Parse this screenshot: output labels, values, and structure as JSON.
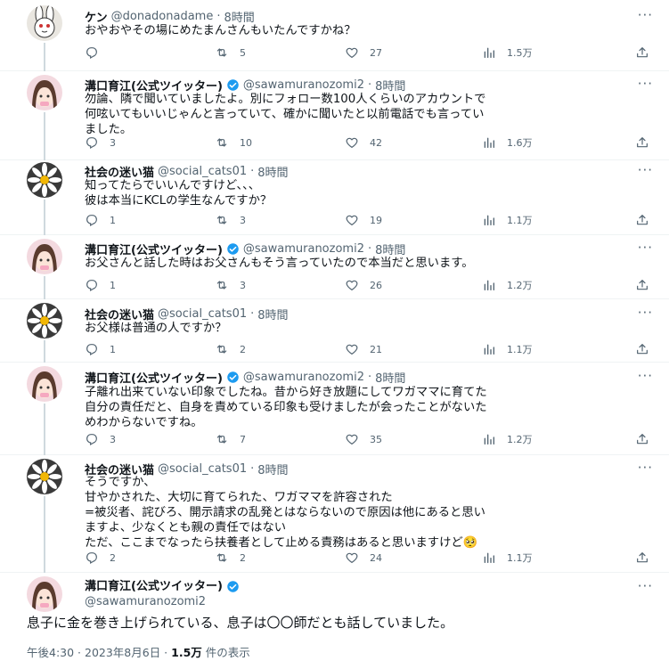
{
  "replies": [
    {
      "name": "ケン",
      "handle": "@donadonadame",
      "separator": "·",
      "time": "8時間",
      "verified": false,
      "avatar": "rabbit-avatar",
      "lines": [
        "おやおやその場にめたまんさんもいたんですかね？"
      ],
      "counts": {
        "reply": "",
        "retweet": "5",
        "like": "27",
        "views": "1.5万"
      }
    },
    {
      "name": "溝口育江(公式ツイッター)",
      "handle": "@sawamuranozomi2",
      "separator": "·",
      "time": "8時間",
      "verified": true,
      "avatar": "girl-avatar",
      "lines": [
        "勿論、隣で聞いていましたよ。別にフォロー数100人くらいのアカウントで",
        "何呟いてもいいじゃんと言っていて、確かに聞いたと以前電話でも言ってい",
        "ました。"
      ],
      "counts": {
        "reply": "3",
        "retweet": "10",
        "like": "42",
        "views": "1.6万"
      }
    },
    {
      "name": "社会の迷い猫",
      "handle": "@social_cats01",
      "separator": "·",
      "time": "8時間",
      "verified": false,
      "avatar": "daisy-avatar",
      "lines": [
        "知ってたらでいいんですけど、、、",
        "彼は本当にKCLの学生なんですか？"
      ],
      "counts": {
        "reply": "1",
        "retweet": "3",
        "like": "19",
        "views": "1.1万"
      }
    },
    {
      "name": "溝口育江(公式ツイッター)",
      "handle": "@sawamuranozomi2",
      "separator": "·",
      "time": "8時間",
      "verified": true,
      "avatar": "girl-avatar",
      "lines": [
        "お父さんと話した時はお父さんもそう言っていたので本当だと思います。"
      ],
      "counts": {
        "reply": "1",
        "retweet": "3",
        "like": "26",
        "views": "1.2万"
      }
    },
    {
      "name": "社会の迷い猫",
      "handle": "@social_cats01",
      "separator": "·",
      "time": "8時間",
      "verified": false,
      "avatar": "daisy-avatar",
      "lines": [
        "お父様は普通の人ですか？"
      ],
      "counts": {
        "reply": "1",
        "retweet": "2",
        "like": "21",
        "views": "1.1万"
      }
    },
    {
      "name": "溝口育江(公式ツイッター)",
      "handle": "@sawamuranozomi2",
      "separator": "·",
      "time": "8時間",
      "verified": true,
      "avatar": "girl-avatar",
      "lines": [
        "子離れ出来ていない印象でしたね。昔から好き放題にしてワガママに育てた",
        "自分の責任だと、自身を責めている印象も受けましたが会ったことがないた",
        "めわからないですね。"
      ],
      "counts": {
        "reply": "3",
        "retweet": "7",
        "like": "35",
        "views": "1.2万"
      }
    },
    {
      "name": "社会の迷い猫",
      "handle": "@social_cats01",
      "separator": "·",
      "time": "8時間",
      "verified": false,
      "avatar": "daisy-avatar",
      "lines": [
        "そうですか、",
        "甘やかされた、大切に育てられた、ワガママを許容された",
        "=被災者、詫びろ、開示請求の乱発とはならないので原因は他にあると思い",
        "ますよ、少なくとも親の責任ではない",
        "ただ、ここまでなったら扶養者として止める責務はあると思いますけど🥺"
      ],
      "counts": {
        "reply": "2",
        "retweet": "2",
        "like": "24",
        "views": "1.1万"
      }
    }
  ],
  "main_tweet": {
    "name": "溝口育江(公式ツイッター)",
    "handle": "@sawamuranozomi2",
    "verified": true,
    "avatar": "girl-avatar",
    "text": "息子に金を巻き上げられている、息子は〇〇師だとも話していました。",
    "timestamp": "午後4:30 · 2023年8月6日 · ",
    "views_count": "1.5万",
    "views_suffix": " 件の表示"
  },
  "icons": {
    "more": "more-horizontal-icon",
    "reply": "reply-icon",
    "retweet": "retweet-icon",
    "like": "heart-icon",
    "views": "views-chart-icon",
    "share": "share-icon",
    "verified": "verified-badge-icon"
  },
  "colors": {
    "text_primary": "#0f1419",
    "text_secondary": "#536471",
    "verified_blue": "#1d9bf0",
    "divider": "#eff3f4",
    "thread_line": "#cfd9de"
  }
}
